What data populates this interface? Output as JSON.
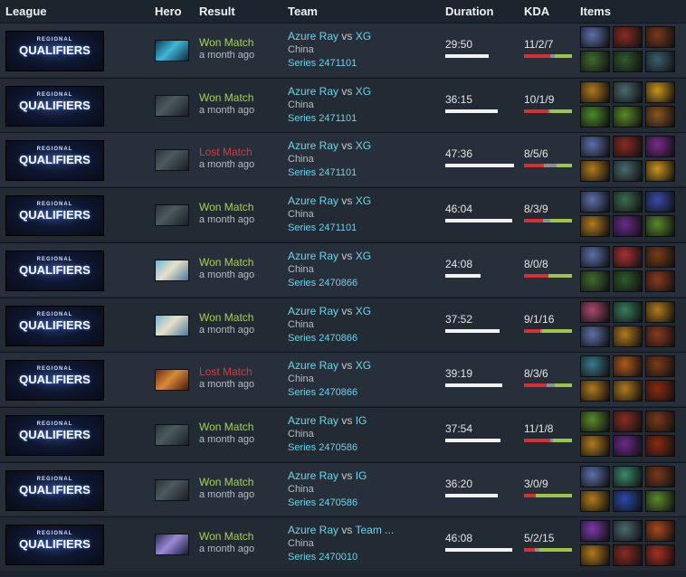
{
  "headers": {
    "league": "League",
    "hero": "Hero",
    "result": "Result",
    "team": "Team",
    "duration": "Duration",
    "kda": "KDA",
    "items": "Items"
  },
  "league_logo_text": {
    "top": "REGIONAL",
    "main": "QUALIFIERS"
  },
  "colors": {
    "won": "#a6d152",
    "lost": "#d43a3a",
    "team_link": "#6fd4e8",
    "kills": "#d63030",
    "deaths": "#8a8f94",
    "assists": "#9ec546"
  },
  "rows": [
    {
      "hero": "hero-icon-cyan",
      "result": "Won Match",
      "outcome": "won",
      "ago": "a month ago",
      "team": "Azure Ray",
      "vs": "vs",
      "opp": "XG",
      "region": "China",
      "series": "Series 2471101",
      "duration": "29:50",
      "kda": "11/2/7",
      "kills": 11,
      "deaths": 2,
      "assists": 7,
      "items": [
        "#5d6fa8",
        "#8a2c22",
        "#7a3a18",
        "#3f6b2e",
        "#2f5a2c",
        "#3a5f6e"
      ]
    },
    {
      "hero": "hero-icon-dark",
      "result": "Won Match",
      "outcome": "won",
      "ago": "a month ago",
      "team": "Azure Ray",
      "vs": "vs",
      "opp": "XG",
      "region": "China",
      "series": "Series 2471101",
      "duration": "36:15",
      "kda": "10/1/9",
      "kills": 10,
      "deaths": 1,
      "assists": 9,
      "items": [
        "#b07a1c",
        "#4a6a6e",
        "#c8941e",
        "#4a8a2a",
        "#5a8a2a",
        "#8a5520"
      ]
    },
    {
      "hero": "hero-icon-dark",
      "result": "Lost Match",
      "outcome": "lost",
      "ago": "a month ago",
      "team": "Azure Ray",
      "vs": "vs",
      "opp": "XG",
      "region": "China",
      "series": "Series 2471101",
      "duration": "47:36",
      "kda": "8/5/6",
      "kills": 8,
      "deaths": 5,
      "assists": 6,
      "items": [
        "#5d6fa8",
        "#8a2c22",
        "#7a2a8a",
        "#b07a1c",
        "#4a6a6e",
        "#c8941e"
      ]
    },
    {
      "hero": "hero-icon-dark",
      "result": "Won Match",
      "outcome": "won",
      "ago": "a month ago",
      "team": "Azure Ray",
      "vs": "vs",
      "opp": "XG",
      "region": "China",
      "series": "Series 2471101",
      "duration": "46:04",
      "kda": "8/3/9",
      "kills": 8,
      "deaths": 3,
      "assists": 9,
      "items": [
        "#5d6fa8",
        "#3a6b4e",
        "#3a4aa8",
        "#b07a1c",
        "#6a2a8a",
        "#5a8a2a"
      ]
    },
    {
      "hero": "hero-icon-light",
      "result": "Won Match",
      "outcome": "won",
      "ago": "a month ago",
      "team": "Azure Ray",
      "vs": "vs",
      "opp": "XG",
      "region": "China",
      "series": "Series 2470866",
      "duration": "24:08",
      "kda": "8/0/8",
      "kills": 8,
      "deaths": 0,
      "assists": 8,
      "items": [
        "#5d6fa8",
        "#a83030",
        "#7a3a18",
        "#3f6b2e",
        "#2f5a2c",
        "#8a3a20"
      ]
    },
    {
      "hero": "hero-icon-light",
      "result": "Won Match",
      "outcome": "won",
      "ago": "a month ago",
      "team": "Azure Ray",
      "vs": "vs",
      "opp": "XG",
      "region": "China",
      "series": "Series 2470866",
      "duration": "37:52",
      "kda": "9/1/16",
      "kills": 9,
      "deaths": 1,
      "assists": 16,
      "items": [
        "#a84a6a",
        "#3a7a5e",
        "#b07a1c",
        "#5d6fa8",
        "#b07a1c",
        "#8a3a20"
      ]
    },
    {
      "hero": "hero-icon-orange",
      "result": "Lost Match",
      "outcome": "lost",
      "ago": "a month ago",
      "team": "Azure Ray",
      "vs": "vs",
      "opp": "XG",
      "region": "China",
      "series": "Series 2470866",
      "duration": "39:19",
      "kda": "8/3/6",
      "kills": 8,
      "deaths": 3,
      "assists": 6,
      "items": [
        "#3a7a8a",
        "#b05a1c",
        "#7a3a18",
        "#b07a1c",
        "#b07a1c",
        "#8a2a10"
      ]
    },
    {
      "hero": "hero-icon-dark",
      "result": "Won Match",
      "outcome": "won",
      "ago": "a month ago",
      "team": "Azure Ray",
      "vs": "vs",
      "opp": "IG",
      "region": "China",
      "series": "Series 2470586",
      "duration": "37:54",
      "kda": "11/1/8",
      "kills": 11,
      "deaths": 1,
      "assists": 8,
      "items": [
        "#5a8a2a",
        "#8a2c22",
        "#7a3a18",
        "#b07a1c",
        "#6a2a8a",
        "#8a2a10"
      ]
    },
    {
      "hero": "hero-icon-dark",
      "result": "Won Match",
      "outcome": "won",
      "ago": "a month ago",
      "team": "Azure Ray",
      "vs": "vs",
      "opp": "IG",
      "region": "China",
      "series": "Series 2470586",
      "duration": "36:20",
      "kda": "3/0/9",
      "kills": 3,
      "deaths": 0,
      "assists": 9,
      "items": [
        "#5d6fa8",
        "#3a8a6e",
        "#7a3a18",
        "#b07a1c",
        "#2a4aa8",
        "#5a8a2a"
      ]
    },
    {
      "hero": "hero-icon-purple",
      "result": "Won Match",
      "outcome": "won",
      "ago": "a month ago",
      "team": "Azure Ray",
      "vs": "vs",
      "opp": "Team ...",
      "region": "China",
      "series": "Series 2470010",
      "duration": "46:08",
      "kda": "5/2/15",
      "kills": 5,
      "deaths": 2,
      "assists": 15,
      "items": [
        "#7a3aa8",
        "#4a6a6e",
        "#a84a1c",
        "#b07a1c",
        "#8a2c22",
        "#a83020"
      ]
    }
  ]
}
